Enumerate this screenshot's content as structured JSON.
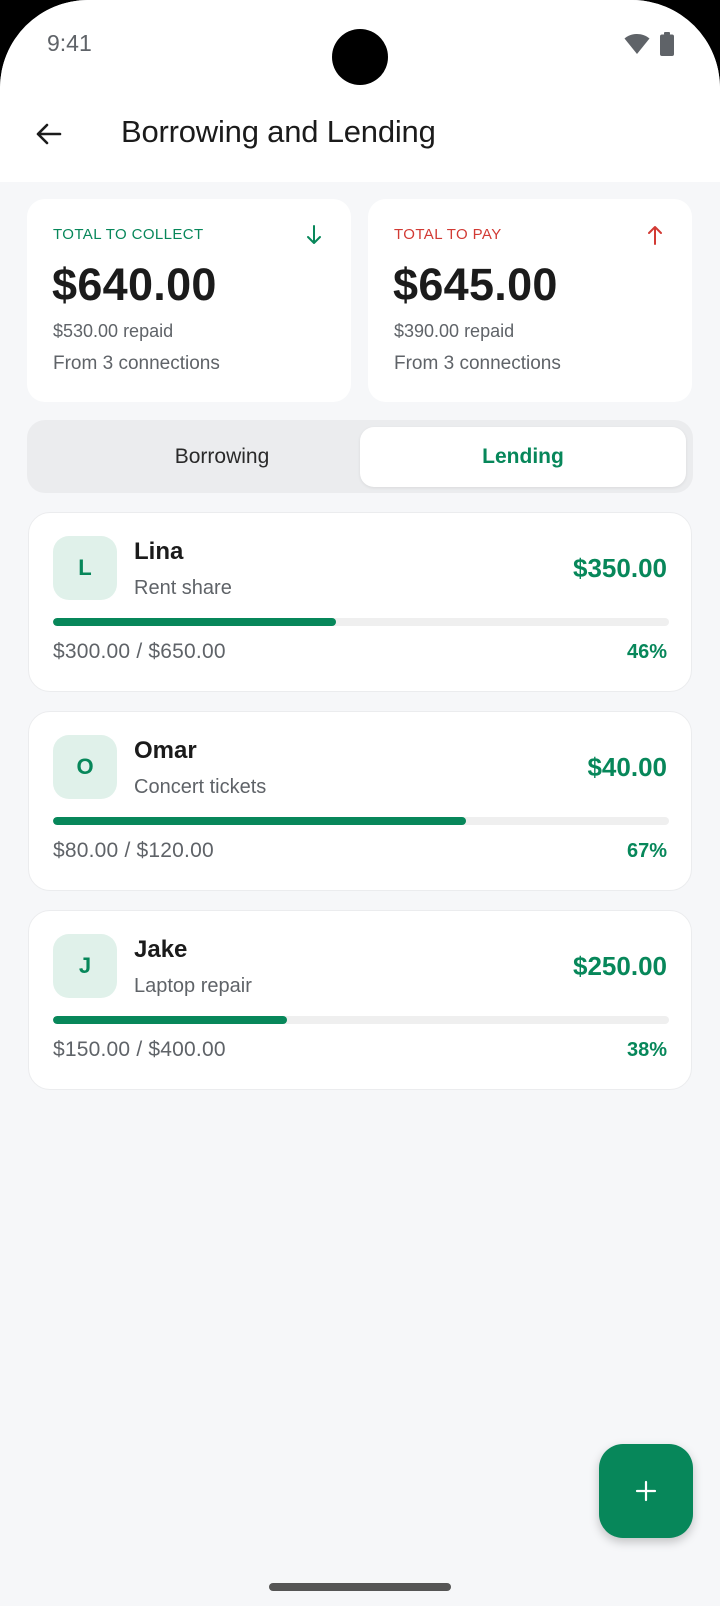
{
  "status_bar": {
    "time": "9:41"
  },
  "header": {
    "title": "Borrowing and Lending"
  },
  "summary": {
    "collect": {
      "label": "TOTAL TO COLLECT",
      "amount": "$640.00",
      "repaid": "$530.00 repaid",
      "connections": "From 3 connections",
      "color": "#07875a"
    },
    "pay": {
      "label": "TOTAL TO PAY",
      "amount": "$645.00",
      "repaid": "$390.00 repaid",
      "connections": "From 3 connections",
      "color": "#d23a34"
    }
  },
  "tabs": {
    "borrowing": "Borrowing",
    "lending": "Lending",
    "selected": "Lending"
  },
  "loans": [
    {
      "initial": "L",
      "name": "Lina",
      "description": "Rent share",
      "amount": "$350.00",
      "progress_text": "$300.00 / $650.00",
      "percent": "46%",
      "fraction": 0.46
    },
    {
      "initial": "O",
      "name": "Omar",
      "description": "Concert tickets",
      "amount": "$40.00",
      "progress_text": "$80.00 / $120.00",
      "percent": "67%",
      "fraction": 0.67
    },
    {
      "initial": "J",
      "name": "Jake",
      "description": "Laptop repair",
      "amount": "$250.00",
      "progress_text": "$150.00 / $400.00",
      "percent": "38%",
      "fraction": 0.38
    }
  ],
  "fab": {
    "icon": "plus-icon"
  },
  "colors": {
    "accent": "#07875a",
    "negative": "#d23a34",
    "background": "#f6f7f9"
  }
}
